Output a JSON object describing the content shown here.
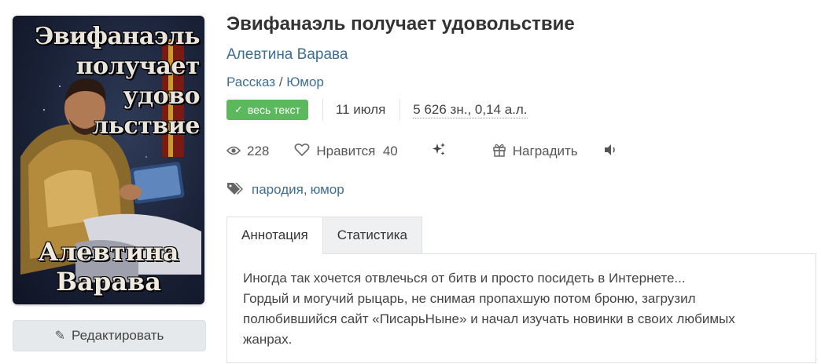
{
  "cover": {
    "title_text": "Эвифанаэль\nполучает\nудово\nльствие",
    "author_text": "Алевтина\nВарава"
  },
  "edit_button": {
    "icon": "pencil-icon",
    "label": "Редактировать"
  },
  "book": {
    "title": "Эвифанаэль получает удовольствие",
    "author": "Алевтина Варава",
    "genres": [
      "Рассказ",
      "Юмор"
    ],
    "genre_separator": " / ",
    "status_badge": "весь текст",
    "date": "11 июля",
    "size": "5 626 зн., 0,14 а.л."
  },
  "stats": {
    "views": "228",
    "likes_label": "Нравится",
    "likes_count": "40",
    "reward_label": "Наградить"
  },
  "tags": [
    "пародия",
    "юмор"
  ],
  "tabs": [
    {
      "label": "Аннотация",
      "active": true
    },
    {
      "label": "Статистика",
      "active": false
    }
  ],
  "annotation": {
    "lines": [
      "Иногда так хочется отвлечься от битв и просто посидеть в Интернете...",
      "Гордый и могучий рыцарь, не снимая пропахшую потом броню, загрузил",
      "полюбившийся сайт «ПисарьНыне» и начал изучать новинки в своих любимых",
      "жанрах."
    ]
  },
  "colors": {
    "link": "#3d6e94",
    "badge_green": "#5cb85c",
    "button_bg": "#e6e9ec"
  }
}
